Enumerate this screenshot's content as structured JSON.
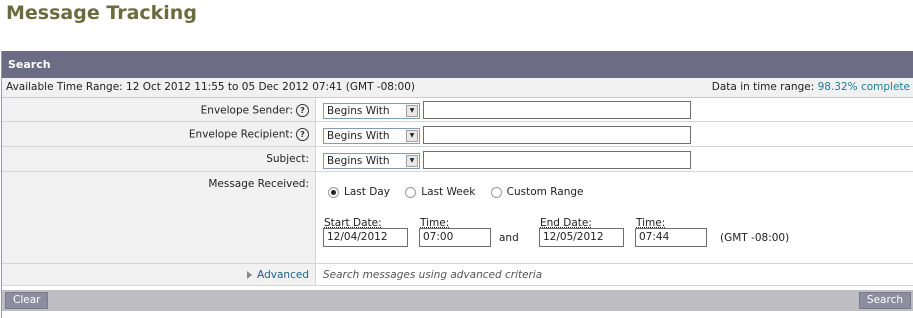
{
  "page": {
    "title": "Message Tracking"
  },
  "panel": {
    "header": "Search",
    "time_range_label": "Available Time Range: 12 Oct 2012 11:55 to 05 Dec 2012 07:41 (GMT -08:00)",
    "data_in_range_label": "Data in time range:",
    "data_in_range_value": "98.32% complete"
  },
  "fields": {
    "envelope_sender": {
      "label": "Envelope Sender:",
      "operator": "Begins With",
      "value": ""
    },
    "envelope_recipient": {
      "label": "Envelope Recipient:",
      "operator": "Begins With",
      "value": ""
    },
    "subject": {
      "label": "Subject:",
      "operator": "Begins With",
      "value": ""
    },
    "help_glyph": "?"
  },
  "received": {
    "label": "Message Received:",
    "options": [
      "Last Day",
      "Last Week",
      "Custom Range"
    ],
    "selected": "Last Day",
    "start_date_label": "Start Date:",
    "start_date": "12/04/2012",
    "start_time_label": "Time:",
    "start_time": "07:00",
    "and_label": "and",
    "end_date_label": "End Date:",
    "end_date": "12/05/2012",
    "end_time_label": "Time:",
    "end_time": "07:44",
    "timezone": "(GMT -08:00)"
  },
  "advanced": {
    "link_label": "Advanced",
    "description": "Search messages using advanced criteria"
  },
  "footer": {
    "clear_label": "Clear",
    "search_label": "Search"
  },
  "colors": {
    "header_bg": "#6c6c84",
    "title": "#6b6b3f",
    "link": "#1f7a96"
  }
}
